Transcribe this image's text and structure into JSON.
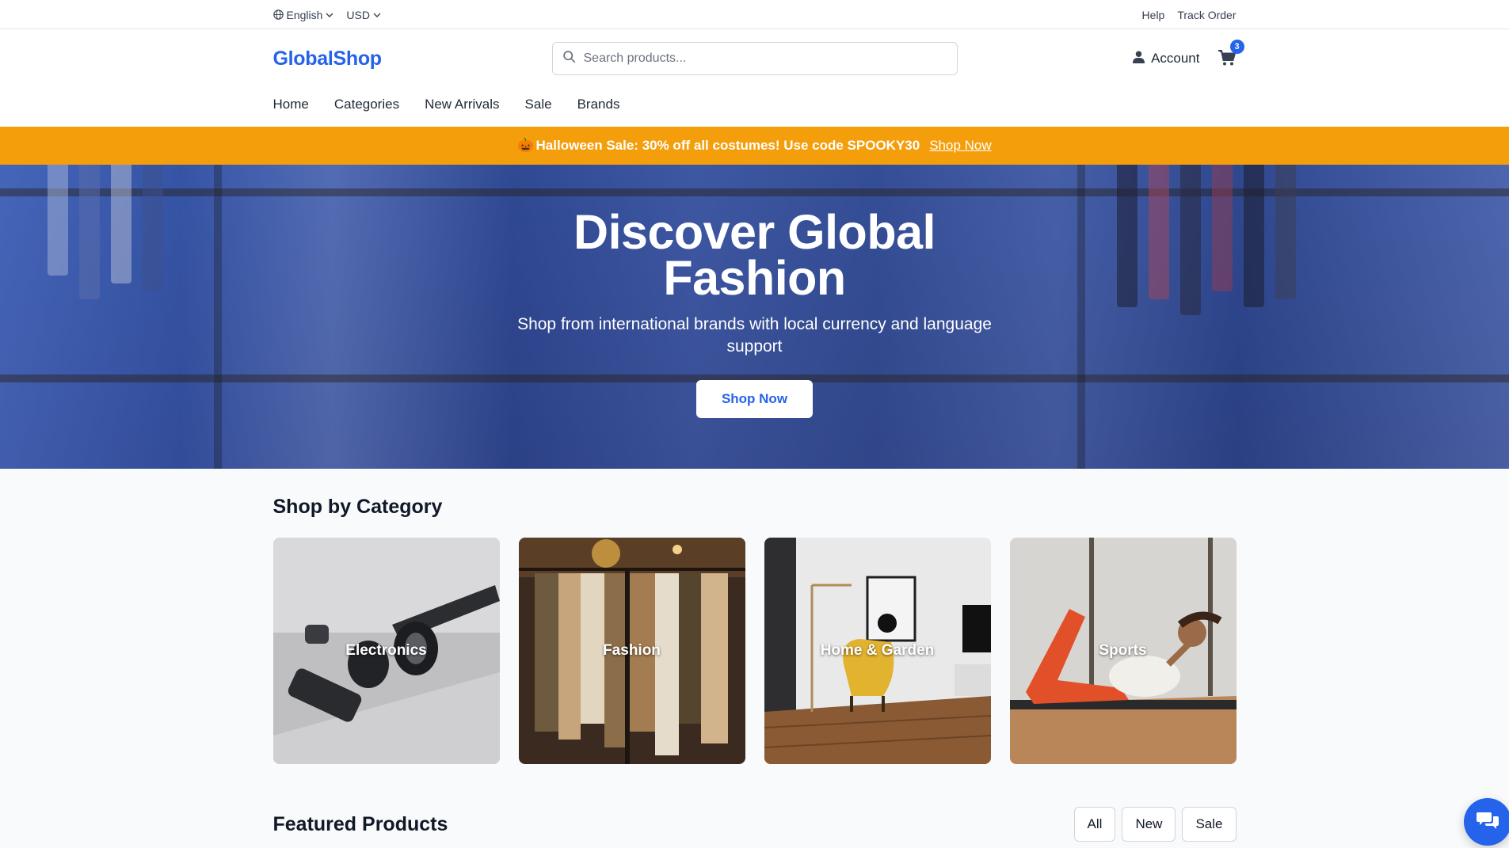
{
  "topbar": {
    "language": "English",
    "currency": "USD",
    "help": "Help",
    "track_order": "Track Order"
  },
  "header": {
    "logo": "GlobalShop",
    "search_placeholder": "Search products...",
    "account": "Account",
    "cart_count": "3"
  },
  "nav": [
    "Home",
    "Categories",
    "New Arrivals",
    "Sale",
    "Brands"
  ],
  "promo": {
    "emoji": "🎃",
    "text": "Halloween Sale: 30% off all costumes! Use code SPOOKY30",
    "link": "Shop Now"
  },
  "hero": {
    "title": "Discover Global Fashion",
    "subtitle": "Shop from international brands with local currency and language support",
    "cta": "Shop Now"
  },
  "categories": {
    "title": "Shop by Category",
    "items": [
      "Electronics",
      "Fashion",
      "Home & Garden",
      "Sports"
    ]
  },
  "featured": {
    "title": "Featured Products",
    "filters": [
      "All",
      "New",
      "Sale"
    ]
  },
  "icons": {
    "globe": "globe-icon",
    "chevron": "chevron-down-icon",
    "search": "search-icon",
    "user": "user-icon",
    "cart": "cart-icon",
    "chat": "chat-icon"
  },
  "colors": {
    "brand": "#2563eb",
    "promo": "#f59e0b"
  }
}
